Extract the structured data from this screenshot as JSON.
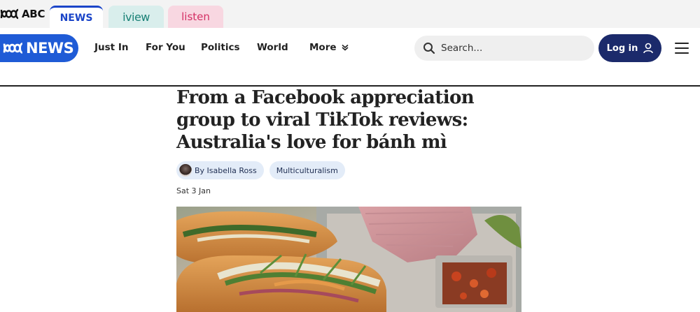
{
  "network": {
    "abc_label": "ABC",
    "tabs": [
      {
        "label": "NEWS",
        "active": true,
        "color": "#1a44c8"
      },
      {
        "label": "iview",
        "active": false,
        "color": "#1b8277"
      },
      {
        "label": "listen",
        "active": false,
        "color": "#d42f64"
      }
    ]
  },
  "header": {
    "logo_text": "NEWS",
    "nav": [
      {
        "label": "Just In"
      },
      {
        "label": "For You"
      },
      {
        "label": "Politics"
      },
      {
        "label": "World"
      },
      {
        "label": "More"
      }
    ],
    "search_placeholder": "Search...",
    "login_label": "Log in",
    "brand_color": "#1f5bd6",
    "login_color": "#1b2a6b"
  },
  "article": {
    "headline": "From a Facebook appreciation group to viral TikTok reviews: Australia's love for bánh mì",
    "author": "By Isabella Ross",
    "topic": "Multiculturalism",
    "date": "Sat 3 Jan",
    "image_icon": "banh-mi-photo"
  }
}
